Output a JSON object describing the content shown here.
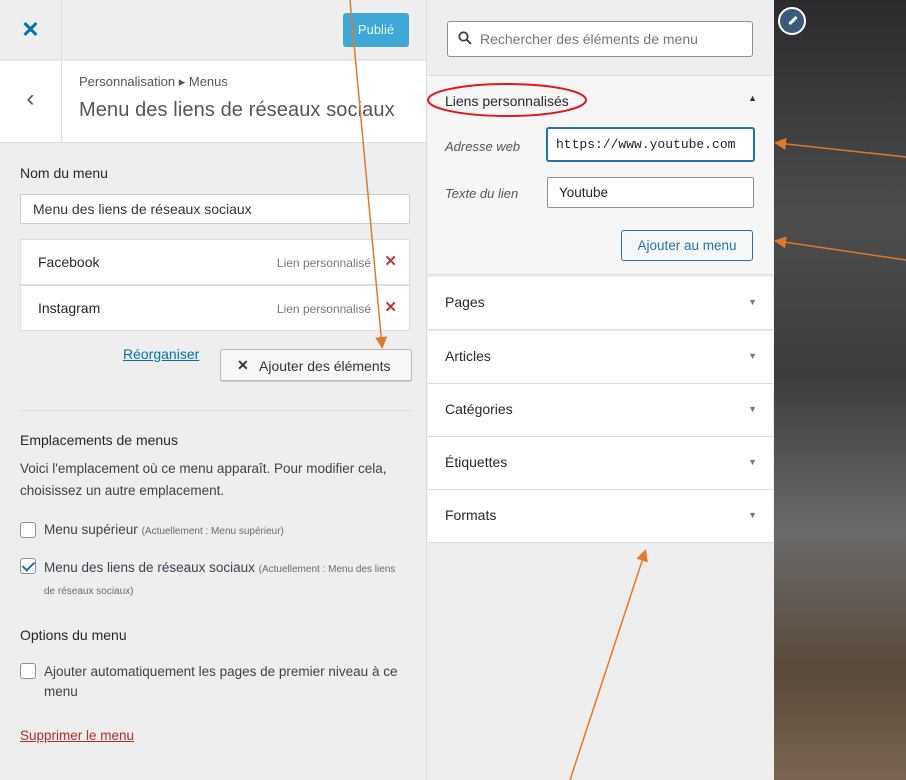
{
  "topbar": {
    "close_icon": "close-icon",
    "publish_label": "Publié"
  },
  "section": {
    "back_icon": "chevron-left-icon",
    "breadcrumb": "Personnalisation ▸ Menus",
    "title": "Menu des liens de réseaux sociaux"
  },
  "menu_name": {
    "label": "Nom du menu",
    "value": "Menu des liens de réseaux sociaux"
  },
  "menu_items": [
    {
      "title": "Facebook",
      "type": "Lien personnalisé",
      "delete": "✕"
    },
    {
      "title": "Instagram",
      "type": "Lien personnalisé",
      "delete": "✕"
    }
  ],
  "actions": {
    "reorder": "Réorganiser",
    "add_items_icon": "✕",
    "add_items": "Ajouter des éléments"
  },
  "locations": {
    "title": "Emplacements de menus",
    "description": "Voici l'emplacement où ce menu apparaît. Pour modifier cela, choisissez un autre emplacement.",
    "items": [
      {
        "label": "Menu supérieur",
        "note": "(Actuellement : Menu supérieur)",
        "checked": false
      },
      {
        "label": "Menu des liens de réseaux sociaux",
        "note": "(Actuellement : Menu des liens de réseaux sociaux)",
        "checked": true
      }
    ]
  },
  "options": {
    "title": "Options du menu",
    "auto_add": "Ajouter automatiquement les pages de premier niveau à ce menu",
    "auto_add_checked": false
  },
  "delete_menu": "Supprimer le menu",
  "search": {
    "icon": "search-icon",
    "placeholder": "Rechercher des éléments de menu"
  },
  "custom_links": {
    "title": "Liens personnalisés",
    "toggle": "▲",
    "url_label": "Adresse web",
    "url_value": "https://www.youtube.com",
    "text_label": "Texte du lien",
    "text_value": "Youtube",
    "add_button": "Ajouter au menu"
  },
  "accordions": [
    {
      "title": "Pages",
      "arrow": "▼"
    },
    {
      "title": "Articles",
      "arrow": "▼"
    },
    {
      "title": "Catégories",
      "arrow": "▼"
    },
    {
      "title": "Étiquettes",
      "arrow": "▼"
    },
    {
      "title": "Formats",
      "arrow": "▼"
    }
  ],
  "preview": {
    "edit_icon": "pencil-icon"
  },
  "colors": {
    "accent": "#0073aa",
    "publish": "#3fa8d6",
    "annotation_arrow": "#e07a2a",
    "annotation_circle": "#e0191e",
    "delete": "#b32d2e"
  }
}
